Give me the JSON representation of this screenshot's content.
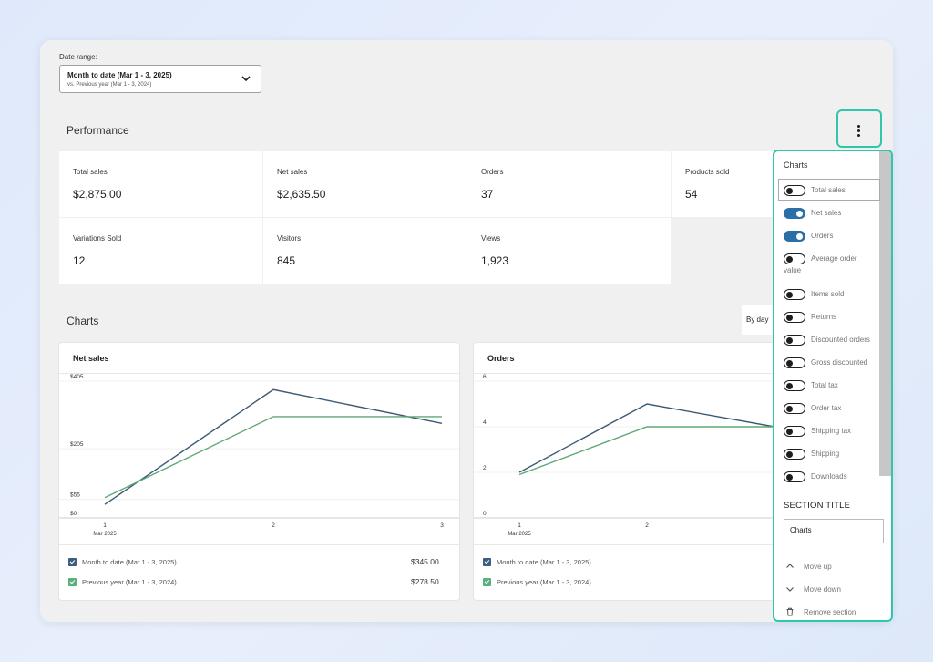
{
  "date_range": {
    "label": "Date range:",
    "main": "Month to date (Mar 1 - 3, 2025)",
    "compare": "vs. Previous year (Mar 1 - 3, 2024)"
  },
  "performance": {
    "title": "Performance",
    "stats": [
      {
        "label": "Total sales",
        "value": "$2,875.00"
      },
      {
        "label": "Net sales",
        "value": "$2,635.50"
      },
      {
        "label": "Orders",
        "value": "37"
      },
      {
        "label": "Products sold",
        "value": "54"
      },
      {
        "label": "Variations Sold",
        "value": "12"
      },
      {
        "label": "Visitors",
        "value": "845"
      },
      {
        "label": "Views",
        "value": "1,923"
      }
    ]
  },
  "charts_section": {
    "title": "Charts",
    "interval": "By day",
    "legend": {
      "current": "Month to date (Mar 1 - 3, 2025)",
      "previous": "Previous year (Mar 1 - 3, 2024)"
    },
    "colors": {
      "current": "#3b5a73",
      "previous": "#5fa877",
      "check_current": "#3d5e80",
      "check_previous": "#5aaf7a"
    }
  },
  "chart_data": [
    {
      "type": "line",
      "title": "Net sales",
      "x": [
        "1",
        "2",
        "3"
      ],
      "x_sublabel": "Mar 2025",
      "y_ticks": [
        "$0",
        "$55",
        "$205",
        "$405"
      ],
      "ylim": [
        0,
        405
      ],
      "series": [
        {
          "name": "Month to date (Mar 1 - 3, 2025)",
          "values": [
            40,
            380,
            280
          ],
          "total": "$345.00"
        },
        {
          "name": "Previous year (Mar 1 - 3, 2024)",
          "values": [
            60,
            300,
            300
          ],
          "total": "$278.50"
        }
      ]
    },
    {
      "type": "line",
      "title": "Orders",
      "x": [
        "1",
        "2",
        "3"
      ],
      "x_sublabel": "Mar 2025",
      "y_ticks": [
        "0",
        "2",
        "4",
        "6"
      ],
      "ylim": [
        0,
        6
      ],
      "series": [
        {
          "name": "Month to date (Mar 1 - 3, 2025)",
          "values": [
            2,
            5,
            4
          ]
        },
        {
          "name": "Previous year (Mar 1 - 3, 2024)",
          "values": [
            1.9,
            4,
            4
          ]
        }
      ]
    }
  ],
  "menu": {
    "heading": "Charts",
    "toggles": [
      {
        "label": "Total sales",
        "on": false
      },
      {
        "label": "Net sales",
        "on": true
      },
      {
        "label": "Orders",
        "on": true
      },
      {
        "label": "Average order",
        "label2": "value",
        "on": false
      },
      {
        "label": "Items sold",
        "on": false
      },
      {
        "label": "Returns",
        "on": false
      },
      {
        "label": "Discounted orders",
        "on": false
      },
      {
        "label": "Gross discounted",
        "on": false
      },
      {
        "label": "Total tax",
        "on": false
      },
      {
        "label": "Order tax",
        "on": false
      },
      {
        "label": "Shipping tax",
        "on": false
      },
      {
        "label": "Shipping",
        "on": false
      },
      {
        "label": "Downloads",
        "on": false
      }
    ],
    "section_title_label": "SECTION TITLE",
    "section_title_value": "Charts",
    "actions": {
      "move_up": "Move up",
      "move_down": "Move down",
      "remove": "Remove section"
    }
  }
}
